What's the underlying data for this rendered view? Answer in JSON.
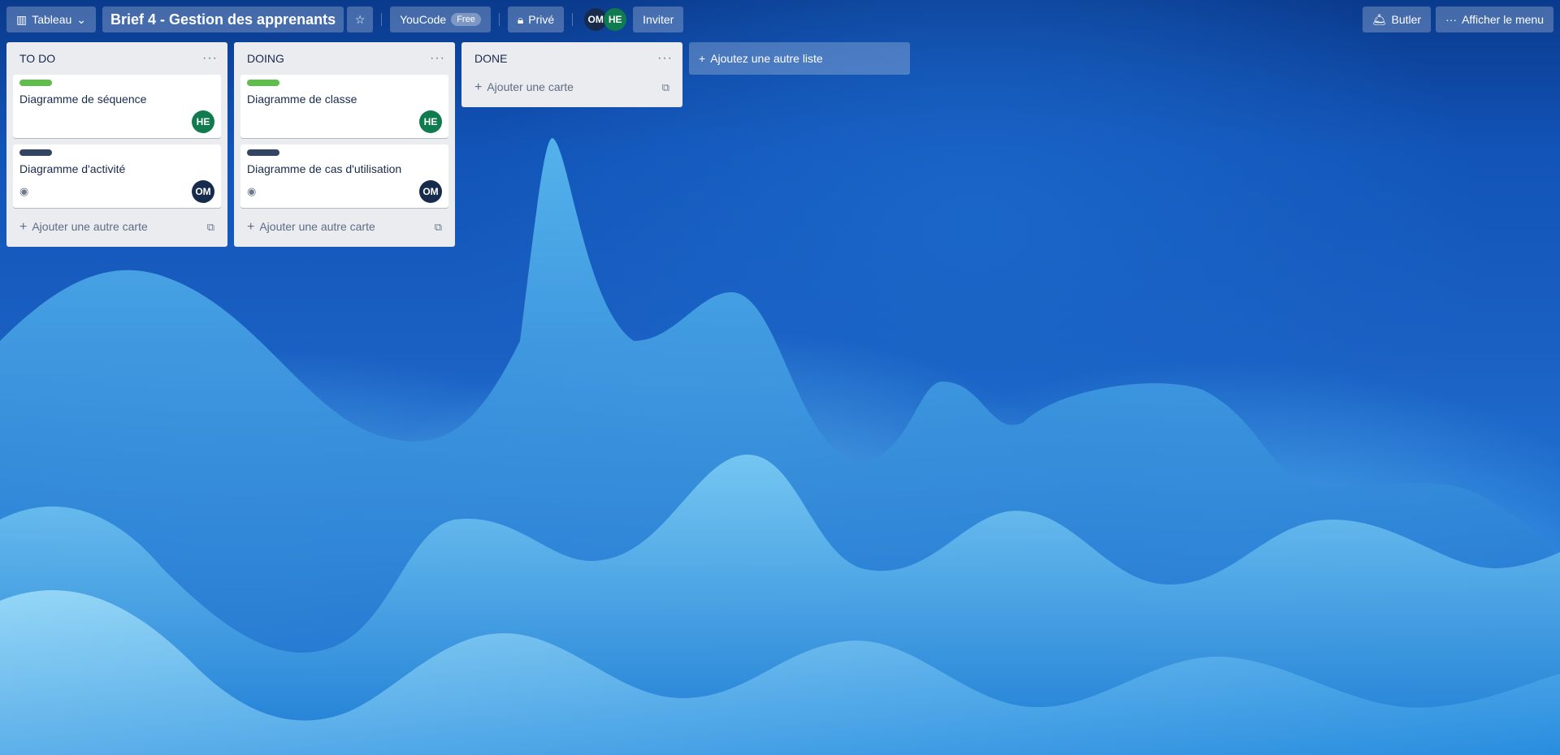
{
  "header": {
    "view_switcher": "Tableau",
    "board_title": "Brief 4 - Gestion des apprenants",
    "workspace": "YouCode",
    "workspace_plan": "Free",
    "visibility": "Privé",
    "members": [
      {
        "initials": "OM",
        "color": "#172b4d"
      },
      {
        "initials": "HE",
        "color": "#0f7b4f"
      }
    ],
    "invite": "Inviter",
    "butler": "Butler",
    "show_menu": "Afficher le menu"
  },
  "lists": [
    {
      "title": "TO DO",
      "cards": [
        {
          "title": "Diagramme de séquence",
          "label_color": "#61bd4f",
          "member": "HE",
          "member_color": "#0f7b4f",
          "watching": false
        },
        {
          "title": "Diagramme d'activité",
          "label_color": "#344563",
          "member": "OM",
          "member_color": "#172b4d",
          "watching": true
        }
      ],
      "add_card": "Ajouter une autre carte"
    },
    {
      "title": "DOING",
      "cards": [
        {
          "title": "Diagramme de classe",
          "label_color": "#61bd4f",
          "member": "HE",
          "member_color": "#0f7b4f",
          "watching": false
        },
        {
          "title": "Diagramme de cas d'utilisation",
          "label_color": "#344563",
          "member": "OM",
          "member_color": "#172b4d",
          "watching": true
        }
      ],
      "add_card": "Ajouter une autre carte"
    },
    {
      "title": "DONE",
      "cards": [],
      "add_card": "Ajouter une carte"
    }
  ],
  "add_list": "Ajoutez une autre liste"
}
